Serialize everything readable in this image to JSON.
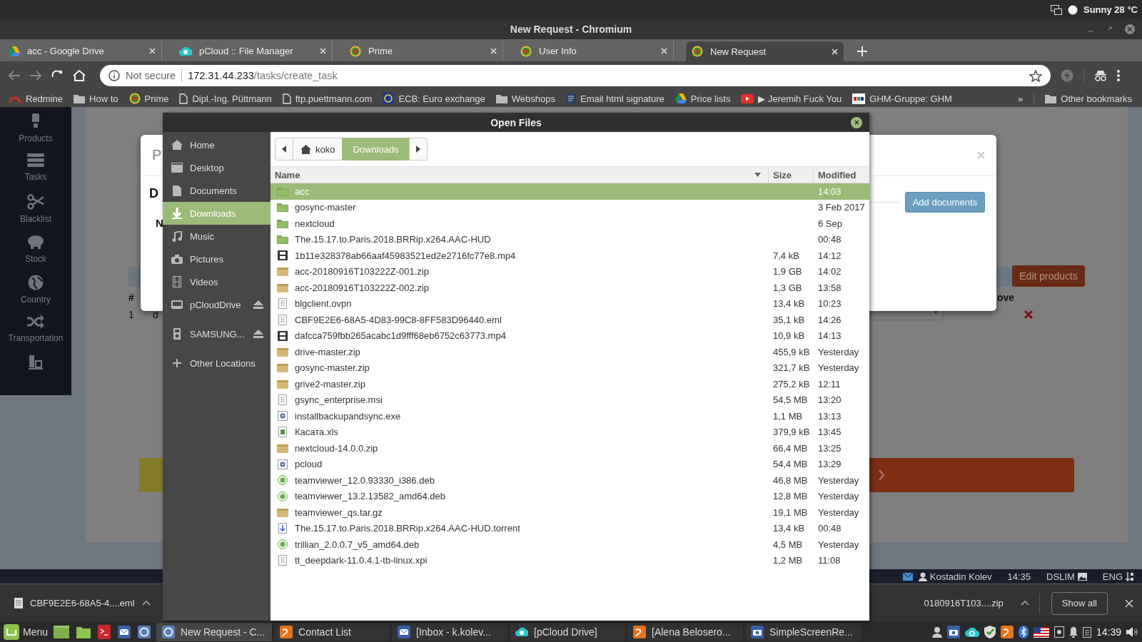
{
  "top_panel": {
    "weather": "Sunny 28 °C"
  },
  "window": {
    "title": "New Request - Chromium"
  },
  "tabs": [
    {
      "title": "acc - Google Drive",
      "kind": "drive",
      "selected": false
    },
    {
      "title": "pCloud :: File Manager",
      "kind": "pcloud",
      "selected": false
    },
    {
      "title": "Prime",
      "kind": "prime",
      "selected": false
    },
    {
      "title": "User Info",
      "kind": "prime",
      "selected": false
    },
    {
      "title": "New Request",
      "kind": "prime",
      "selected": true
    }
  ],
  "address_bar": {
    "security": "Not secure",
    "host": "172.31.44.233",
    "path": "/tasks/create_task"
  },
  "bookmarks": [
    {
      "label": "Redmine",
      "kind": "redmine"
    },
    {
      "label": "How to",
      "kind": "folder"
    },
    {
      "label": "Prime",
      "kind": "prime"
    },
    {
      "label": "Dipl.-Ing. Püttmann",
      "kind": "page"
    },
    {
      "label": "ftp.puettmann.com",
      "kind": "page"
    },
    {
      "label": "ECB: Euro exchange",
      "kind": "ecb"
    },
    {
      "label": "Webshops",
      "kind": "folder"
    },
    {
      "label": "Email html signature",
      "kind": "lines"
    },
    {
      "label": "Price lists",
      "kind": "drive"
    },
    {
      "label": "▶ Jeremih Fuck You",
      "kind": "youtube"
    },
    {
      "label": "GHM-Gruppe: GHM",
      "kind": "ghm"
    }
  ],
  "bookmarks_more": "»",
  "other_bookmarks": "Other bookmarks",
  "page": {
    "nav": [
      {
        "label": "Products",
        "kind": "products"
      },
      {
        "label": "Tasks",
        "kind": "tasks"
      },
      {
        "label": "Blacklist",
        "kind": "blacklist"
      },
      {
        "label": "Stock",
        "kind": "stock"
      },
      {
        "label": "Country",
        "kind": "country"
      },
      {
        "label": "Transportation",
        "kind": "transportation"
      },
      {
        "kind": "chart"
      }
    ],
    "edit_button": "Edit products",
    "table": {
      "columns": [
        "#",
        "ove"
      ],
      "rows": [
        {
          "number": "1",
          "name": "d"
        }
      ]
    },
    "modal": {
      "title": "P",
      "heading": "D",
      "label": "N",
      "button": "Add documents"
    },
    "status": {
      "user": "Kostadin Kolev",
      "time": "14:35",
      "connection": "DSLIM",
      "language": "ENG"
    }
  },
  "file_dialog": {
    "title": "Open Files",
    "places": [
      {
        "label": "Home",
        "kind": "home",
        "selected": false,
        "eject": false
      },
      {
        "label": "Desktop",
        "kind": "desktop",
        "selected": false,
        "eject": false
      },
      {
        "label": "Documents",
        "kind": "documents",
        "selected": false,
        "eject": false
      },
      {
        "label": "Downloads",
        "kind": "downloads",
        "selected": true,
        "eject": false
      },
      {
        "label": "Music",
        "kind": "music",
        "selected": false,
        "eject": false
      },
      {
        "label": "Pictures",
        "kind": "pictures",
        "selected": false,
        "eject": false
      },
      {
        "label": "Videos",
        "kind": "videos",
        "selected": false,
        "eject": false
      },
      {
        "label": "pCloudDrive",
        "kind": "drive",
        "selected": false,
        "eject": true
      },
      {
        "label": "SAMSUNG...",
        "kind": "device",
        "selected": false,
        "eject": true
      },
      {
        "label": "Other Locations",
        "kind": "other",
        "selected": false,
        "eject": false
      }
    ],
    "path": [
      {
        "label": "koko",
        "kind": "home",
        "selected": false
      },
      {
        "label": "Downloads",
        "kind": "folder",
        "selected": true
      }
    ],
    "columns": [
      "Name",
      "Size",
      "Modified"
    ],
    "files": [
      {
        "name": "acc",
        "kind": "folder",
        "modified": "14:03",
        "selected": true
      },
      {
        "name": "gosync-master",
        "kind": "folder",
        "modified": "3 Feb 2017",
        "selected": false
      },
      {
        "name": "nextcloud",
        "kind": "folder",
        "modified": "6 Sep",
        "selected": false
      },
      {
        "name": "The.15.17.to.Paris.2018.BRRip.x264.AAC-HUD",
        "kind": "folder",
        "modified": "00:48",
        "selected": false
      },
      {
        "name": "1b11e328378ab66aaf45983521ed2e2716fc77e8.mp4",
        "kind": "video",
        "size": "7,4 kB",
        "modified": "14:12",
        "selected": false
      },
      {
        "name": "acc-20180916T103222Z-001.zip",
        "kind": "archive",
        "size": "1,9 GB",
        "modified": "14:02",
        "selected": false
      },
      {
        "name": "acc-20180916T103222Z-002.zip",
        "kind": "archive",
        "size": "1,3 GB",
        "modified": "13:58",
        "selected": false
      },
      {
        "name": "blgclient.ovpn",
        "kind": "text",
        "size": "13,4 kB",
        "modified": "10:23",
        "selected": false
      },
      {
        "name": "CBF9E2E6-68A5-4D83-99C8-8FF583D96440.eml",
        "kind": "text",
        "size": "35,1 kB",
        "modified": "14:26",
        "selected": false
      },
      {
        "name": "dafcca759fbb265acabc1d9fff68eb6752c63773.mp4",
        "kind": "video",
        "size": "10,9 kB",
        "modified": "14:13",
        "selected": false
      },
      {
        "name": "drive-master.zip",
        "kind": "archive",
        "size": "455,9 kB",
        "modified": "Yesterday",
        "selected": false
      },
      {
        "name": "gosync-master.zip",
        "kind": "archive",
        "size": "321,7 kB",
        "modified": "Yesterday",
        "selected": false
      },
      {
        "name": "grive2-master.zip",
        "kind": "archive",
        "size": "275,2 kB",
        "modified": "12:11",
        "selected": false
      },
      {
        "name": "gsync_enterprise.msi",
        "kind": "text",
        "size": "54,5 MB",
        "modified": "13:20",
        "selected": false
      },
      {
        "name": "installbackupandsync.exe",
        "kind": "exec",
        "size": "1,1 MB",
        "modified": "13:13",
        "selected": false
      },
      {
        "name": "Касата.xls",
        "kind": "sheet",
        "size": "379,9 kB",
        "modified": "13:45",
        "selected": false
      },
      {
        "name": "nextcloud-14.0.0.zip",
        "kind": "archive",
        "size": "66,4 MB",
        "modified": "13:25",
        "selected": false
      },
      {
        "name": "pcloud",
        "kind": "exec",
        "size": "54,4 MB",
        "modified": "13:29",
        "selected": false
      },
      {
        "name": "teamviewer_12.0.93330_i386.deb",
        "kind": "deb",
        "size": "46,8 MB",
        "modified": "Yesterday",
        "selected": false
      },
      {
        "name": "teamviewer_13.2.13582_amd64.deb",
        "kind": "deb",
        "size": "12,8 MB",
        "modified": "Yesterday",
        "selected": false
      },
      {
        "name": "teamviewer_qs.tar.gz",
        "kind": "archive",
        "size": "19,1 MB",
        "modified": "Yesterday",
        "selected": false
      },
      {
        "name": "The.15.17.to.Paris.2018.BRRip.x264.AAC-HUD.torrent",
        "kind": "torrent",
        "size": "13,4 kB",
        "modified": "00:48",
        "selected": false
      },
      {
        "name": "trillian_2.0.0.7_v5_amd64.deb",
        "kind": "deb",
        "size": "4,5 MB",
        "modified": "Yesterday",
        "selected": false
      },
      {
        "name": "tt_deepdark-11.0.4.1-tb-linux.xpi",
        "kind": "text",
        "size": "1,2 MB",
        "modified": "11:08",
        "selected": false
      }
    ]
  },
  "download_shelf": {
    "items": [
      "CBF9E2E6-68A5-4....eml",
      "0180916T103....zip"
    ],
    "show_all": "Show all"
  },
  "taskbar": {
    "menu": "Menu",
    "windows": [
      {
        "title": "New Request - C...",
        "kind": "browser",
        "selected": true
      },
      {
        "title": "Contact List",
        "kind": "chat",
        "selected": false
      },
      {
        "title": "[Inbox - k.kolev...",
        "kind": "mail",
        "selected": false
      },
      {
        "title": "[pCloud Drive]",
        "kind": "pcloud",
        "selected": false
      },
      {
        "title": "[Alena Belosero...",
        "kind": "chat",
        "selected": false
      },
      {
        "title": "SimpleScreenRe...",
        "kind": "camera",
        "selected": false
      }
    ],
    "clock": "14:39"
  }
}
